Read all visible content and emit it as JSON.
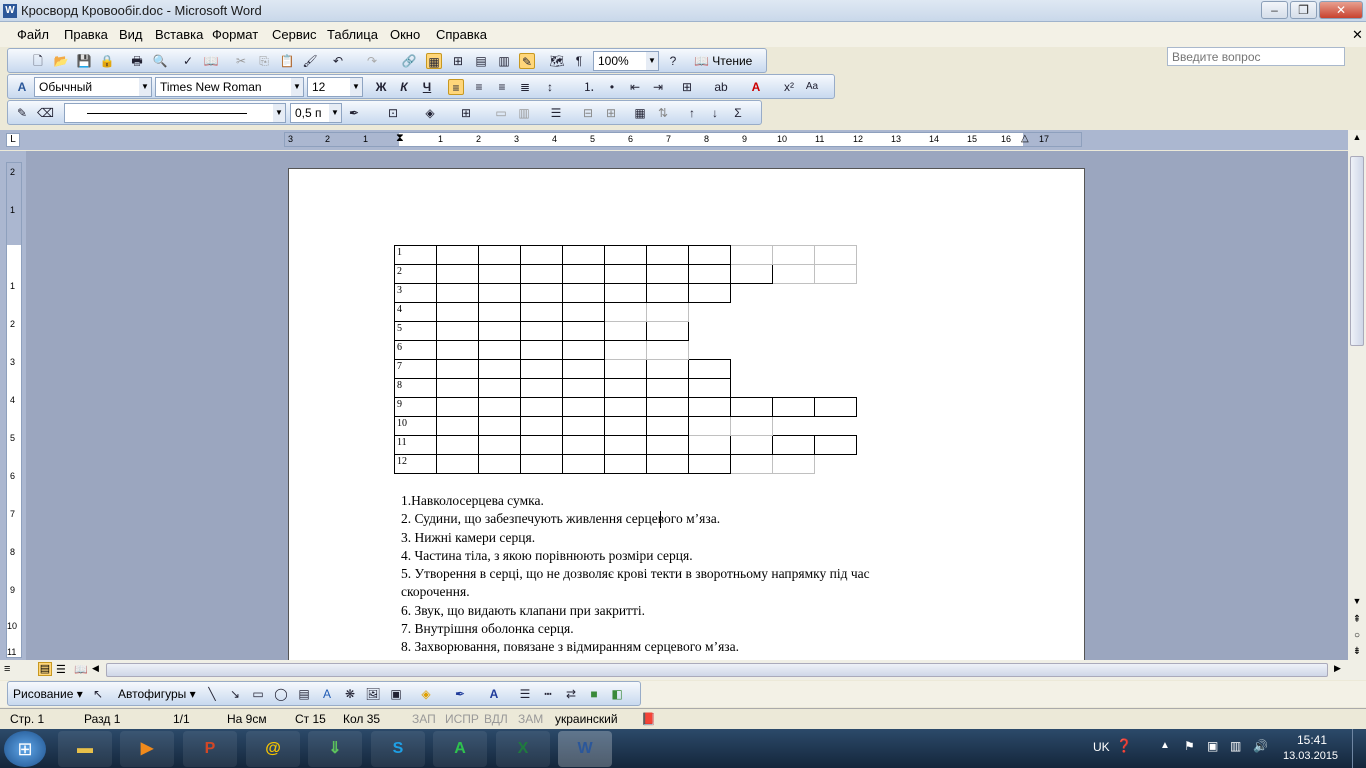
{
  "window": {
    "title": "Кросворд Кровообіг.doc - Microsoft Word",
    "min": "–",
    "max": "❐",
    "close": "✕"
  },
  "menu": [
    "Файл",
    "Правка",
    "Вид",
    "Вставка",
    "Формат",
    "Сервис",
    "Таблица",
    "Окно",
    "Справка"
  ],
  "ask": {
    "placeholder": "Введите вопрос"
  },
  "std_toolbar": {
    "zoom": "100%",
    "reading": "Чтение"
  },
  "fmt_toolbar": {
    "style": "Обычный",
    "font": "Times New Roman",
    "size": "12",
    "bold": "Ж",
    "italic": "К",
    "underline": "Ч"
  },
  "tables_toolbar": {
    "line_weight": "0,5 п"
  },
  "ruler": {
    "h_ticks": [
      "3",
      "2",
      "1",
      "1",
      "2",
      "3",
      "4",
      "5",
      "6",
      "7",
      "8",
      "9",
      "10",
      "11",
      "12",
      "13",
      "14",
      "15",
      "16",
      "17"
    ],
    "v_ticks": [
      "2",
      "1",
      "1",
      "2",
      "3",
      "4",
      "5",
      "6",
      "7",
      "8",
      "9",
      "10",
      "11"
    ]
  },
  "crossword": {
    "rows": [
      {
        "num": "1",
        "cells": "bbbbbbbggggggggggggg"
      },
      {
        "num": "2",
        "cells": "bbbbbbbbgg"
      },
      {
        "num": "3",
        "cells": "bbbbbbb"
      },
      {
        "num": "4",
        "cells": "bbbbgg"
      },
      {
        "num": "5",
        "cells": "bbbbbb"
      },
      {
        "num": "6",
        "cells": "bbbbgg"
      },
      {
        "num": "7",
        "cells": "bbbbbbb"
      },
      {
        "num": "8",
        "cells": "bbbbbbb"
      },
      {
        "num": "9",
        "cells": "bbbbbbbbbbb"
      },
      {
        "num": "10",
        "cells": "bbbbbbgg"
      },
      {
        "num": "11",
        "cells": "bbbbbbbbbb"
      },
      {
        "num": "12",
        "cells": "bbbbbbbgg"
      }
    ]
  },
  "clues": [
    "1.Навколосерцева сумка.",
    "2. Судини, що забезпечують живлення серцевого м’яза.",
    "3. Нижні камери серця.",
    "4. Частина тіла, з якою порівнюють розміри серця.",
    "5. Утворення в серці, що не дозволяє крові текти в зворотньому напрямку під час",
    "скорочення.",
    "6. Звук, що видають клапани при закритті.",
    "7. Внутрішня оболонка серця.",
    "8. Захворювання, повязане з відмиранням серцевого м’яза."
  ],
  "drawbar": {
    "drawing": "Рисование",
    "autoshapes": "Автофигуры"
  },
  "status": {
    "page": "Стр. 1",
    "section": "Разд 1",
    "pages": "1/1",
    "at": "На 9см",
    "line": "Ст 15",
    "col": "Кол 35",
    "rec": "ЗАП",
    "trk": "ИСПР",
    "ext": "ВДЛ",
    "ovr": "ЗАМ",
    "lang": "украинский"
  },
  "taskbar": {
    "lang": "UK",
    "time": "15:41",
    "date": "13.03.2015"
  }
}
